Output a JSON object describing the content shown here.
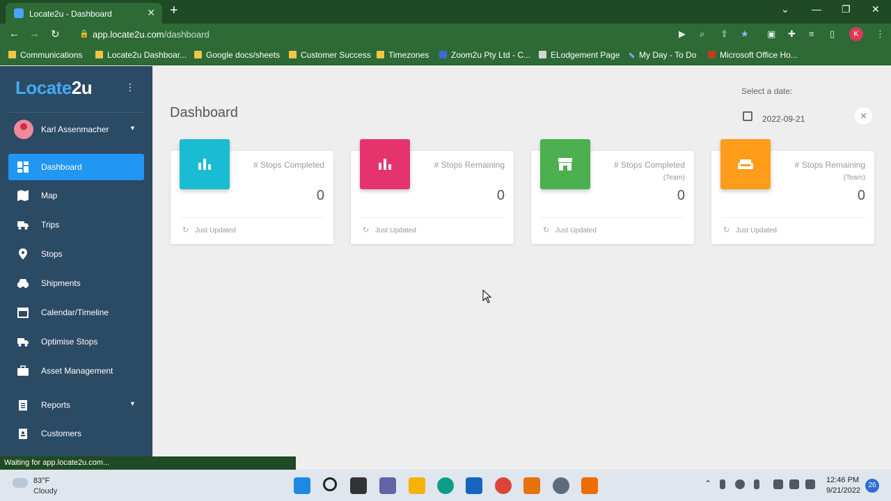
{
  "browser": {
    "tab_title": "Locate2u - Dashboard",
    "tab_close": "✕",
    "new_tab": "+",
    "url_domain": "app.locate2u.com",
    "url_path": "/dashboard",
    "profile_initial": "K",
    "bookmarks": [
      "Communications",
      "Locate2u Dashboar...",
      "Google docs/sheets",
      "Customer Success",
      "Timezones",
      "Zoom2u Pty Ltd - C...",
      "ELodgement Page",
      "My Day - To Do",
      "Microsoft Office Ho..."
    ],
    "status_text": "Waiting for app.locate2u.com..."
  },
  "app": {
    "logo_part1": "Locate",
    "logo_part2": "2u",
    "user_name": "Karl Assenmacher",
    "nav": [
      {
        "label": "Dashboard",
        "icon": "dashboard-icon"
      },
      {
        "label": "Map",
        "icon": "map-icon"
      },
      {
        "label": "Trips",
        "icon": "truck-icon"
      },
      {
        "label": "Stops",
        "icon": "location-pin-icon"
      },
      {
        "label": "Shipments",
        "icon": "car-icon"
      },
      {
        "label": "Calendar/Timeline",
        "icon": "calendar-icon"
      },
      {
        "label": "Optimise Stops",
        "icon": "truck-fast-icon"
      },
      {
        "label": "Asset Management",
        "icon": "briefcase-icon"
      },
      {
        "label": "Reports",
        "icon": "report-icon"
      },
      {
        "label": "Customers",
        "icon": "customer-icon"
      }
    ],
    "page_title": "Dashboard",
    "date_label": "Select a date:",
    "date_value": "2022-09-21",
    "date_clear": "✕",
    "cards": [
      {
        "label": "# Stops Completed",
        "sub": "",
        "value": "0",
        "footer": "Just Updated",
        "color": "#19bcd2",
        "icon": "bar-chart-icon"
      },
      {
        "label": "# Stops Remaining",
        "sub": "",
        "value": "0",
        "footer": "Just Updated",
        "color": "#e5336e",
        "icon": "bar-chart-icon"
      },
      {
        "label": "# Stops Completed",
        "sub": "(Team)",
        "value": "0",
        "footer": "Just Updated",
        "color": "#4caf50",
        "icon": "store-icon"
      },
      {
        "label": "# Stops Remaining",
        "sub": "(Team)",
        "value": "0",
        "footer": "Just Updated",
        "color": "#ff9c1a",
        "icon": "sofa-icon"
      }
    ]
  },
  "taskbar": {
    "weather_temp": "83°F",
    "weather_desc": "Cloudy",
    "time": "12:46 PM",
    "date": "9/21/2022",
    "notifications": "26"
  },
  "colors": {
    "sidebar": "#2b4a64",
    "active_nav": "#2196f3",
    "chrome": "#2d6a35"
  }
}
